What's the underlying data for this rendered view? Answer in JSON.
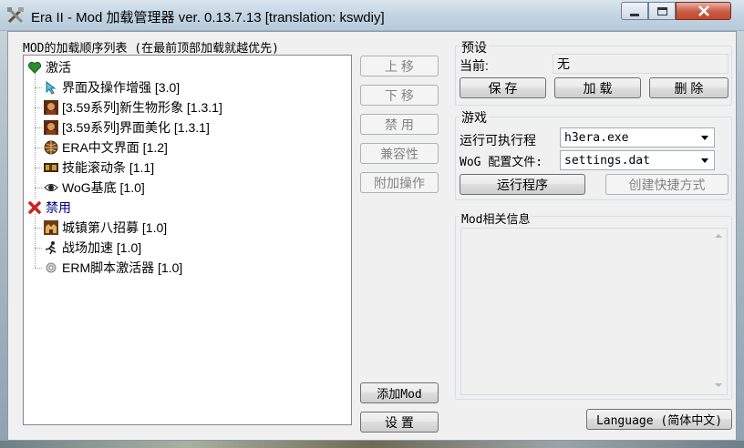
{
  "window": {
    "title": "Era II - Mod 加载管理器 ver. 0.13.7.13 [translation: kswdiy]",
    "icon": "crossed-tools-icon",
    "controls": {
      "minimize": "minimize-icon",
      "maximize": "maximize-icon",
      "close": "close-icon"
    }
  },
  "mod_list": {
    "header": "MOD的加载顺序列表 (在最前顶部加载就越优先)",
    "groups": [
      {
        "label": "激活",
        "icon": "green-heart-icon",
        "color": "#2e8b2e",
        "items": [
          {
            "label": "界面及操作增强 [3.0]",
            "icon": "cursor-icon"
          },
          {
            "label": "[3.59系列]新生物形象 [1.3.1]",
            "icon": "creature-portrait-icon"
          },
          {
            "label": "[3.59系列]界面美化 [1.3.1]",
            "icon": "creature-portrait-icon"
          },
          {
            "label": "ERA中文界面 [1.2]",
            "icon": "globe-icon"
          },
          {
            "label": "技能滚动条 [1.1]",
            "icon": "scroll-bar-icon"
          },
          {
            "label": "WoG基底 [1.0]",
            "icon": "eye-icon"
          }
        ]
      },
      {
        "label": "禁用",
        "icon": "red-x-icon",
        "color": "#cc2222",
        "items": [
          {
            "label": "城镇第八招募 [1.0]",
            "icon": "town-icon"
          },
          {
            "label": "战场加速 [1.0]",
            "icon": "running-man-icon"
          },
          {
            "label": "ERM脚本激活器 [1.0]",
            "icon": "gear-icon"
          }
        ]
      }
    ]
  },
  "mod_buttons": {
    "move_up": "上 移",
    "move_down": "下 移",
    "disable": "禁 用",
    "compat": "兼容性",
    "extra": "附加操作",
    "add_mod": "添加Mod",
    "settings": "设 置"
  },
  "preset": {
    "title": "预设",
    "current_label": "当前:",
    "current_value": "无",
    "save": "保 存",
    "load": "加 载",
    "delete": "删 除"
  },
  "game": {
    "title": "游戏",
    "exe_label": "运行可执行程",
    "exe_value": "h3era.exe",
    "config_label": "WoG 配置文件:",
    "config_value": "settings.dat",
    "run": "运行程序",
    "shortcut": "创建快捷方式"
  },
  "info": {
    "title": "Mod相关信息"
  },
  "language_button": "Language (简体中文)"
}
